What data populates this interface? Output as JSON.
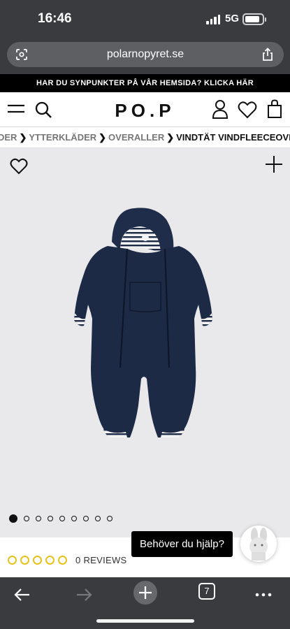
{
  "status_bar": {
    "time": "16:46",
    "network": "5G"
  },
  "browser": {
    "url": "polarnopyret.se",
    "tab_count": "7"
  },
  "site": {
    "announcement": "HAR DU SYNPUNKTER PÅ VÅR HEMSIDA? KLICKA HÄR",
    "logo": "PO.P"
  },
  "breadcrumb": {
    "items": [
      {
        "label": "DER"
      },
      {
        "label": "YTTERKLÄDER"
      },
      {
        "label": "OVERALLER"
      },
      {
        "label": "VINDTÄT VINDFLEECEOVERALL"
      }
    ]
  },
  "gallery": {
    "image_count": 9,
    "active_index": 0
  },
  "product": {
    "rating_stars": 0,
    "reviews_label": "0 REVIEWS"
  },
  "chat": {
    "label": "Behöver du hjälp?"
  },
  "colors": {
    "browser_chrome": "#3a3b3e",
    "accent_star": "#e6c21a",
    "garment": "#1c2a45"
  }
}
